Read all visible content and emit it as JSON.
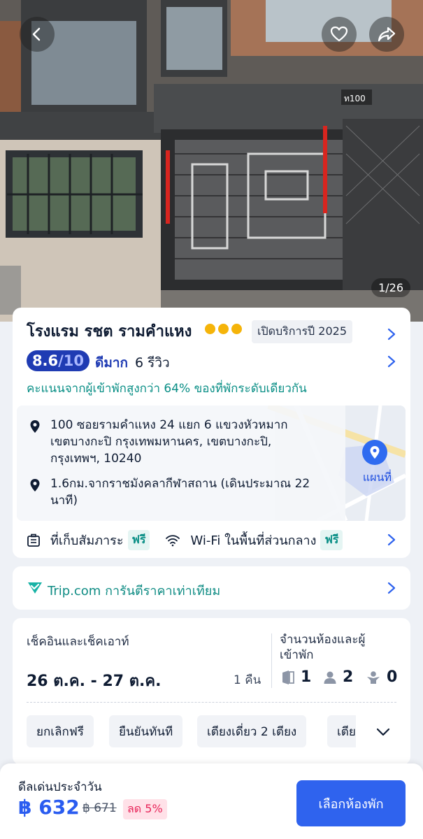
{
  "hero": {
    "photo_counter": "1/26",
    "house_number": "ท100",
    "icons": {
      "back": "back-arrow-icon",
      "favorite": "heart-icon",
      "share": "share-icon"
    }
  },
  "hotel": {
    "name": "โรงแรม รชต รามคำแหง",
    "star_count": 3,
    "open_badge": "เปิดบริการปี 2025",
    "score": "8.6",
    "score_max": "/10",
    "rating_word": "ดีมาก",
    "review_count": "6 รีวิว",
    "compare_text": "คะแนนจากผู้เข้าพักสูงกว่า 64% ของที่พักระดับเดียวกัน"
  },
  "location": {
    "address_line1": "100 ซอยรามคำแหง 24 แยก 6 แขวงหัวหมาก",
    "address_line2": "เขตบางกะปิ กรุงเทพมหานคร, เขตบางกะปิ,",
    "address_line3": "กรุงเทพฯ, 10240",
    "distance_line1": "1.6กม.จากราชมังคลากีฬาสถาน (เดินประมาณ 22",
    "distance_line2": "นาที)",
    "map_label": "แผนที่"
  },
  "amenities": {
    "luggage_label": "ที่เก็บสัมภาระ",
    "luggage_tag": "ฟรี",
    "wifi_label": "Wi-Fi ในพื้นที่ส่วนกลาง",
    "wifi_tag": "ฟรี"
  },
  "guarantee": {
    "text": "Trip.com การันตีราคาเท่าเทียม"
  },
  "booking": {
    "dates_label": "เช็คอินและเช็คเอาท์",
    "dates": "26 ต.ค. - 27 ต.ค.",
    "nights": "1 คืน",
    "rooms_label_line1": "จำนวนห้องและผู้",
    "rooms_label_line2": "เข้าพัก",
    "rooms": "1",
    "adults": "2",
    "children": "0",
    "chips": [
      "ยกเลิกฟรี",
      "ยืนยันทันที",
      "เตียงเดี่ยว 2 เตียง",
      "เตีย"
    ]
  },
  "footer": {
    "deal_label": "ดีลเด่นประจำวัน",
    "price": "฿ 632",
    "old_price": "฿ 671",
    "discount": "ลด 5%",
    "select_button": "เลือกห้องพัก"
  },
  "colors": {
    "brand_blue": "#2f63ee",
    "score_blue": "#1f3bb3",
    "teal": "#0a8f86",
    "star_yellow": "#f5b40a",
    "discount_red": "#e8255a"
  }
}
